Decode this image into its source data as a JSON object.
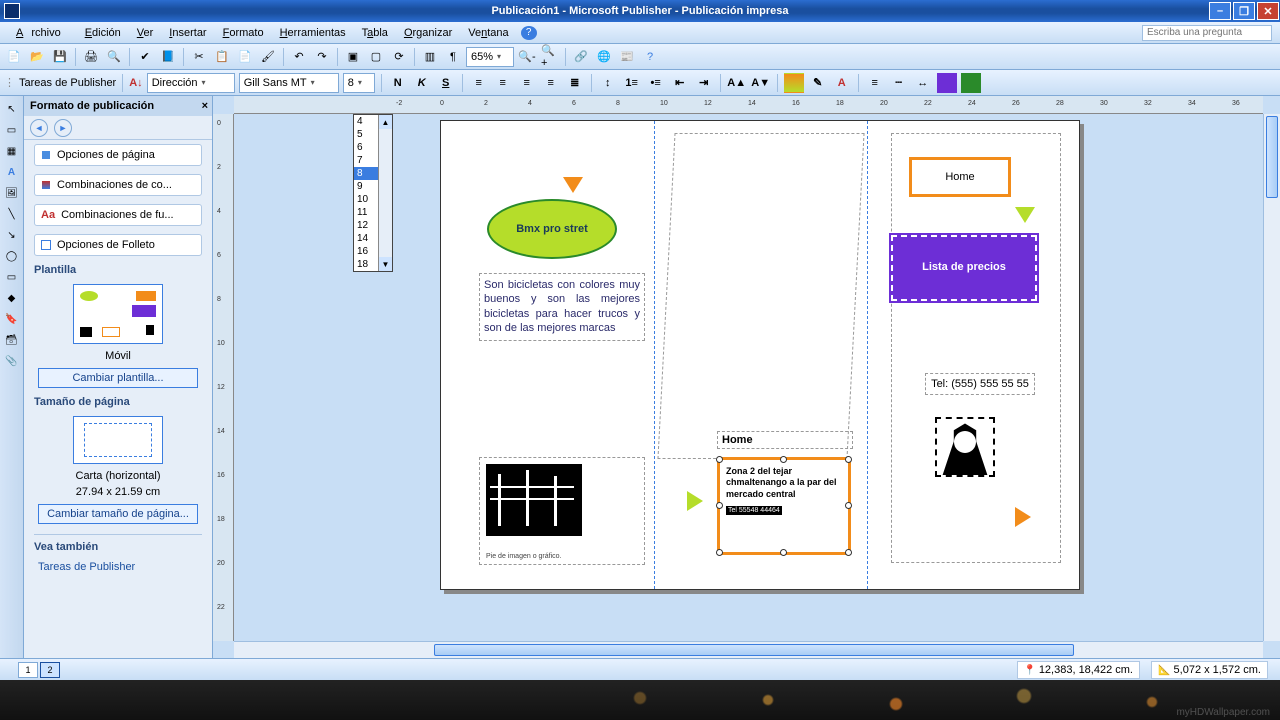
{
  "titlebar": {
    "title": "Publicación1 - Microsoft Publisher -  Publicación impresa"
  },
  "menubar": {
    "items": [
      "Archivo",
      "Edición",
      "Ver",
      "Insertar",
      "Formato",
      "Herramientas",
      "Tabla",
      "Organizar",
      "Ventana"
    ],
    "help_placeholder": "Escriba una pregunta"
  },
  "toolbar1": {
    "zoom": "65%"
  },
  "toolbar2": {
    "tasks_label": "Tareas de Publisher",
    "style_label": "Dirección",
    "font_name": "Gill Sans MT",
    "font_size": "8",
    "size_options": [
      "4",
      "5",
      "6",
      "7",
      "8",
      "9",
      "10",
      "11",
      "12",
      "14",
      "16",
      "18"
    ],
    "btns": {
      "bold": "N",
      "italic": "K",
      "underline": "S"
    }
  },
  "taskpane": {
    "title": "Formato de publicación",
    "opts": {
      "page": "Opciones de página",
      "color": "Combinaciones de co...",
      "font": "Combinaciones de fu...",
      "brochure": "Opciones de Folleto"
    },
    "template_heading": "Plantilla",
    "template_name": "Móvil",
    "change_template": "Cambiar plantilla...",
    "size_heading": "Tamaño de página",
    "size_name": "Carta (horizontal)",
    "size_dims": "27.94 x 21.59 cm",
    "change_size": "Cambiar tamaño de página...",
    "see_also": "Vea también",
    "see_also_link": "Tareas de Publisher"
  },
  "doc": {
    "oval_title": "Bmx pro stret",
    "body_text": "Son bicicletas con colores muy buenos y  son las mejores bicicletas para hacer trucos y son de las mejores marcas",
    "caption": "Pie de imagen o gráfico.",
    "home1": "Home",
    "home2": "Home",
    "address": "Zona 2 del tejar chmaltenango a la par del mercado central",
    "phone_small": "Tel 55548 44464",
    "price_title": "Lista de precios",
    "phone_right": "Tel: (555) 555 55 55"
  },
  "status": {
    "page1": "1",
    "page2": "2",
    "coords": "12,383, 18,422 cm.",
    "dims": "5,072 x  1,572 cm."
  },
  "taskbar": {
    "credit": "myHDWallpaper.com"
  }
}
